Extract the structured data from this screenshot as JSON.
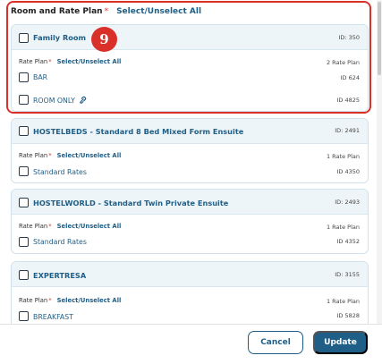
{
  "header": {
    "title": "Room and Rate Plan",
    "required_mark": "*",
    "select_all": "Select/Unselect All"
  },
  "step_badge": "9",
  "rooms": [
    {
      "name": "Family Room",
      "id": "ID: 350",
      "rate_plan_label": "Rate Plan",
      "required_mark": "*",
      "select_all": "Select/Unselect All",
      "count": "2 Rate Plan",
      "plans": [
        {
          "name": "BAR",
          "id": "ID 624"
        },
        {
          "name": "ROOM ONLY",
          "id": "ID 4825",
          "icon": "link-icon"
        }
      ]
    },
    {
      "name": "HOSTELBEDS - Standard 8 Bed Mixed Form Ensuite",
      "id": "ID: 2491",
      "rate_plan_label": "Rate Plan",
      "required_mark": "*",
      "select_all": "Select/Unselect All",
      "count": "1 Rate Plan",
      "plans": [
        {
          "name": "Standard Rates",
          "id": "ID 4350"
        }
      ]
    },
    {
      "name": "HOSTELWORLD - Standard Twin Private Ensuite",
      "id": "ID: 2493",
      "rate_plan_label": "Rate Plan",
      "required_mark": "*",
      "select_all": "Select/Unselect All",
      "count": "1 Rate Plan",
      "plans": [
        {
          "name": "Standard Rates",
          "id": "ID 4352"
        }
      ]
    },
    {
      "name": "EXPERTRESA",
      "id": "ID: 3155",
      "rate_plan_label": "Rate Plan",
      "required_mark": "*",
      "select_all": "Select/Unselect All",
      "count": "1 Rate Plan",
      "plans": [
        {
          "name": "BREAKFAST",
          "id": "ID 5828"
        }
      ]
    }
  ],
  "footer": {
    "cancel": "Cancel",
    "update": "Update"
  },
  "colors": {
    "accent": "#1f5e86",
    "highlight": "#d9302a",
    "required": "#e0312b",
    "card_header": "#eef5f8"
  }
}
